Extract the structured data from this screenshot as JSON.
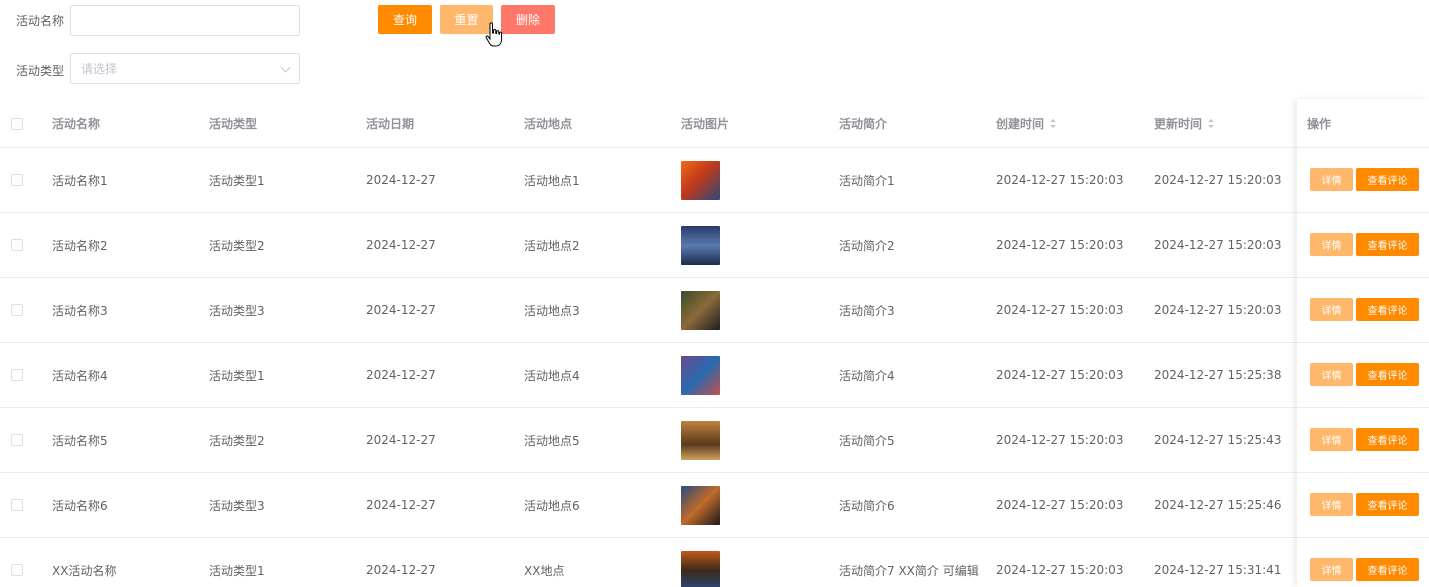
{
  "filters": {
    "name_label": "活动名称",
    "name_value": "",
    "type_label": "活动类型",
    "type_placeholder": "请选择"
  },
  "buttons": {
    "query": "查询",
    "reset": "重置",
    "delete": "删除"
  },
  "table": {
    "headers": {
      "name": "活动名称",
      "type": "活动类型",
      "date": "活动日期",
      "place": "活动地点",
      "image": "活动图片",
      "intro": "活动简介",
      "created": "创建时间",
      "updated": "更新时间",
      "ops": "操作"
    },
    "rows": [
      {
        "name": "活动名称1",
        "type": "活动类型1",
        "date": "2024-12-27",
        "place": "活动地点1",
        "intro": "活动简介1",
        "created": "2024-12-27 15:20:03",
        "updated": "2024-12-27 15:20:03"
      },
      {
        "name": "活动名称2",
        "type": "活动类型2",
        "date": "2024-12-27",
        "place": "活动地点2",
        "intro": "活动简介2",
        "created": "2024-12-27 15:20:03",
        "updated": "2024-12-27 15:20:03"
      },
      {
        "name": "活动名称3",
        "type": "活动类型3",
        "date": "2024-12-27",
        "place": "活动地点3",
        "intro": "活动简介3",
        "created": "2024-12-27 15:20:03",
        "updated": "2024-12-27 15:20:03"
      },
      {
        "name": "活动名称4",
        "type": "活动类型1",
        "date": "2024-12-27",
        "place": "活动地点4",
        "intro": "活动简介4",
        "created": "2024-12-27 15:20:03",
        "updated": "2024-12-27 15:25:38"
      },
      {
        "name": "活动名称5",
        "type": "活动类型2",
        "date": "2024-12-27",
        "place": "活动地点5",
        "intro": "活动简介5",
        "created": "2024-12-27 15:20:03",
        "updated": "2024-12-27 15:25:43"
      },
      {
        "name": "活动名称6",
        "type": "活动类型3",
        "date": "2024-12-27",
        "place": "活动地点6",
        "intro": "活动简介6",
        "created": "2024-12-27 15:20:03",
        "updated": "2024-12-27 15:25:46"
      },
      {
        "name": "XX活动名称",
        "type": "活动类型1",
        "date": "2024-12-27",
        "place": "XX地点",
        "intro": "活动简介7 XX简介 可编辑",
        "created": "2024-12-27 15:20:03",
        "updated": "2024-12-27 15:31:41"
      }
    ],
    "row_actions": {
      "detail": "详情",
      "comments": "查看评论"
    }
  },
  "colors": {
    "primary": "#ff8a00",
    "light": "#ffb86b",
    "danger": "#ff7768"
  }
}
